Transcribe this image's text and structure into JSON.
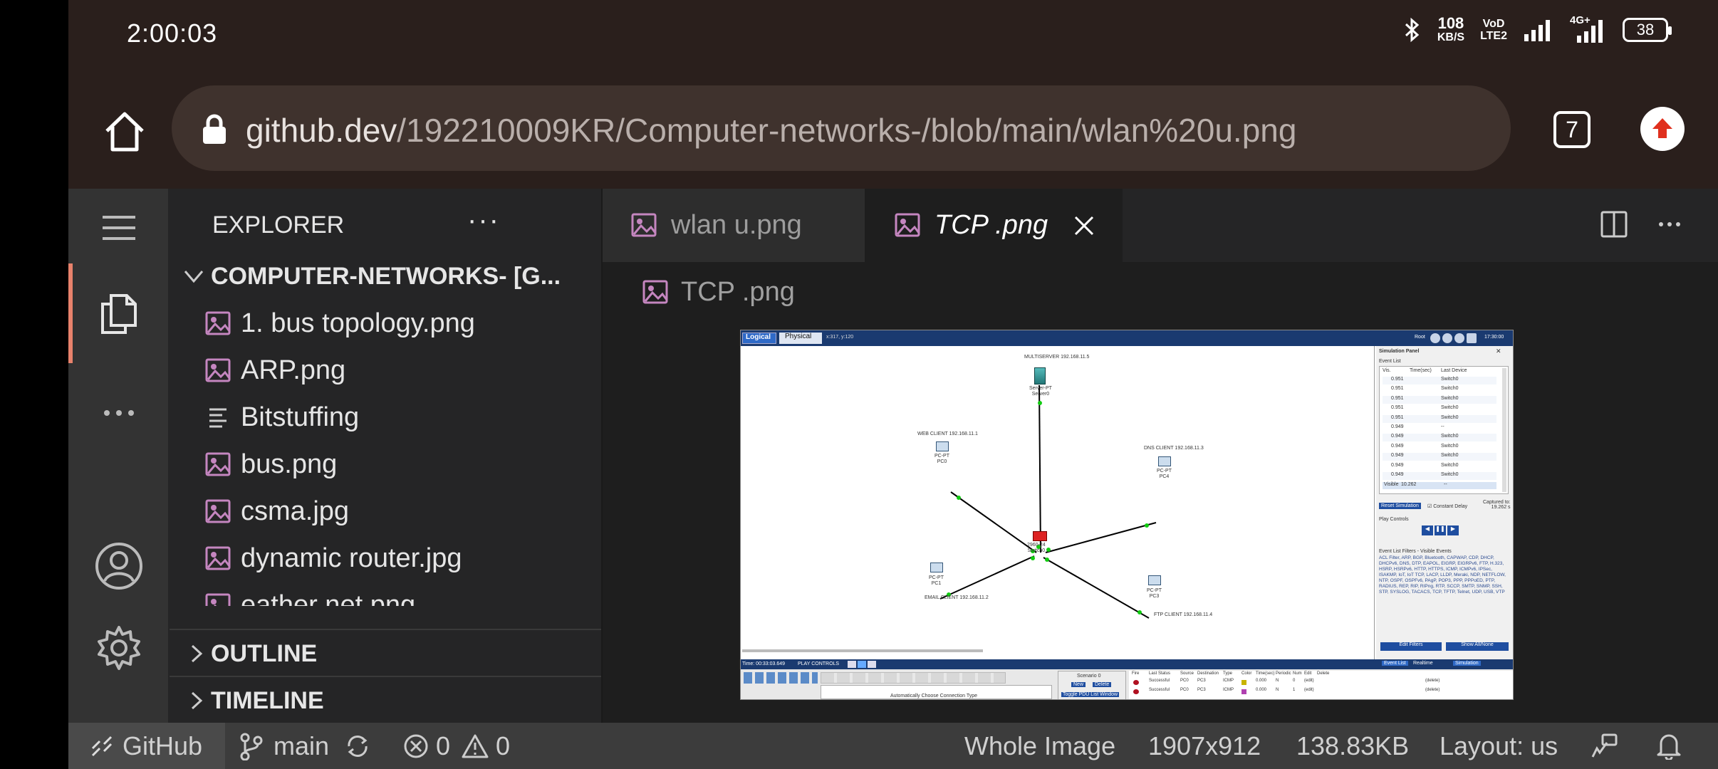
{
  "status_bar": {
    "time": "2:00:03",
    "net_speed_value": "108",
    "net_speed_unit": "KB/S",
    "volte_top": "VoD",
    "volte_bottom": "LTE2",
    "network_type": "4G+",
    "battery": "38",
    "icons": [
      "bluetooth-icon",
      "signal-icon",
      "signal-4g-icon",
      "battery-icon"
    ]
  },
  "browser": {
    "url_domain": "github.dev",
    "url_path": "/192210009KR/Computer-networks-/blob/main/wlan%20u.png",
    "tab_count": "7",
    "icons": [
      "home-icon",
      "lock-icon",
      "update-icon"
    ]
  },
  "explorer": {
    "title": "EXPLORER",
    "more": "···",
    "repo": "COMPUTER-NETWORKS- [G...",
    "files": [
      {
        "name": "1. bus topology.png",
        "icon": "image-file-icon"
      },
      {
        "name": "ARP.png",
        "icon": "image-file-icon"
      },
      {
        "name": "Bitstuffing",
        "icon": "text-file-icon"
      },
      {
        "name": "bus.png",
        "icon": "image-file-icon"
      },
      {
        "name": "csma.jpg",
        "icon": "image-file-icon"
      },
      {
        "name": "dynamic router.jpg",
        "icon": "image-file-icon"
      },
      {
        "name": "eather net.png",
        "icon": "image-file-icon"
      }
    ],
    "outline": "OUTLINE",
    "timeline": "TIMELINE"
  },
  "activity_bar": {
    "icons": [
      "menu-icon",
      "files-icon",
      "more-icon",
      "account-icon",
      "settings-icon"
    ]
  },
  "editor": {
    "tabs": [
      {
        "label": "wlan u.png",
        "active": false
      },
      {
        "label": "TCP .png",
        "active": true
      }
    ],
    "breadcrumb": "TCP .png",
    "accent": "#c586c0"
  },
  "status_line": {
    "remote": "GitHub",
    "branch": "main",
    "errors": "0",
    "warnings": "0",
    "view_mode": "Whole Image",
    "dimensions": "1907x912",
    "size": "138.83KB",
    "layout": "Layout: us"
  },
  "packet_tracer": {
    "mode_logical": "Logical",
    "mode_physical": "Physical",
    "coords": "x:317, y:120",
    "toolbar_root": "Root",
    "clock": "17:30:00",
    "devices": [
      {
        "label": "MULTISERVER 192.168.11.5",
        "name": "Server-PT\nServer0"
      },
      {
        "label": "WEB CLIENT 192.168.11.1",
        "name": "PC-PT\nPC0"
      },
      {
        "label": "DNS CLIENT 192.168.11.3",
        "name": "PC-PT\nPC4"
      },
      {
        "label": "",
        "name": "2960-24\nSwitch0"
      },
      {
        "label": "EMAIL CLIENT 192.168.11.2",
        "name": "PC-PT\nPC1"
      },
      {
        "label": "FTP CLIENT 192.168.11.4",
        "name": "PC-PT\nPC3"
      }
    ],
    "sim_panel_title": "Simulation Panel",
    "event_list_title": "Event List",
    "event_headers": [
      "Vis.",
      "Time(sec)",
      "Last Device"
    ],
    "events": [
      [
        "0.951",
        "Switch0"
      ],
      [
        "0.951",
        "Switch0"
      ],
      [
        "0.951",
        "Switch0"
      ],
      [
        "0.951",
        "Switch0"
      ],
      [
        "0.951",
        "Switch0"
      ],
      [
        "0.949",
        "--"
      ],
      [
        "0.949",
        "Switch0"
      ],
      [
        "0.949",
        "Switch0"
      ],
      [
        "0.949",
        "Switch0"
      ],
      [
        "0.949",
        "Switch0"
      ],
      [
        "0.949",
        "Switch0"
      ]
    ],
    "visible_row": [
      "Visible",
      "10.262",
      "--"
    ],
    "reset_simulation": "Reset Simulation",
    "constant_delay": "Constant Delay",
    "captured_to": "Captured to:",
    "captured_value": "19.262 s",
    "play_controls": "Play Controls",
    "filters_title": "Event List Filters - Visible Events",
    "filters_text": "ACL Filter, ARP, BGP, Bluetooth, CAPWAP, CDP, DHCP, DHCPv6, DNS, DTP, EAPOL, EIGRP, EIGRPv6, FTP, H.323, HSRP, HSRPv6, HTTP, HTTPS, ICMP, ICMPv6, IPSec, ISAKMP, IoT, IoT TCP, LACP, LLDP, Meraki, NDP, NETFLOW, NTP, OSPF, OSPFv6, PAgP, POP3, PPP, PPPoED, PTP, RADIUS, REP, RIP, RIPng, RTP, SCCP, SMTP, SNMP, SSH, STP, SYSLOG, TACACS, TCP, TFTP, Telnet, UDP, USB, VTP",
    "edit_filters": "Edit Filters",
    "show_all": "Show All/None",
    "time_label": "Time: 00:33:03.649",
    "play_controls_bottom": "PLAY CONTROLS",
    "event_list_btn": "Event List",
    "realtime": "Realtime",
    "simulation": "Simulation",
    "auto_connection": "Automatically Choose Connection Type",
    "scenario": "Scenario 0",
    "new_btn": "New",
    "delete_btn": "Delete",
    "toggle_pdu": "Toggle PDU List Window",
    "pdu_headers": [
      "Fire",
      "Last Status",
      "Source",
      "Destination",
      "Type",
      "Color",
      "Time(sec)",
      "Periodic",
      "Num",
      "Edit",
      "Delete"
    ],
    "pdu_rows": [
      [
        "Successful",
        "PC0",
        "PC3",
        "ICMP",
        "#c8b400",
        "0.000",
        "N",
        "0",
        "(edit)",
        "(delete)"
      ],
      [
        "Successful",
        "PC0",
        "PC3",
        "ICMP",
        "#b040b0",
        "0.000",
        "N",
        "1",
        "(edit)",
        "(delete)"
      ]
    ]
  }
}
